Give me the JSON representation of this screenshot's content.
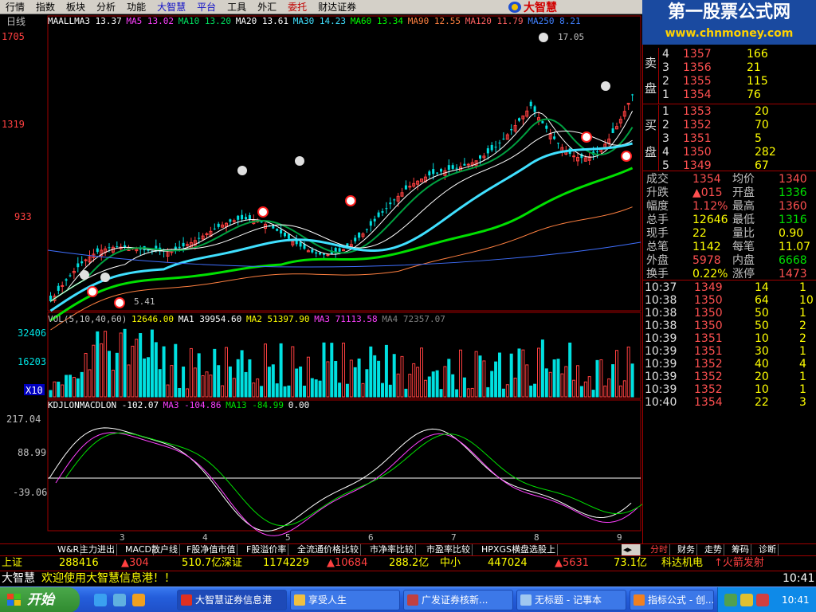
{
  "menubar": {
    "items": [
      "行情",
      "指数",
      "板块",
      "分析",
      "功能",
      "大智慧",
      "平台",
      "工具",
      "外汇",
      "委托",
      "财达证券"
    ]
  },
  "logo": {
    "text": "大智慧"
  },
  "banner": {
    "title": "第一股票公式网",
    "url": "www.chnmoney.com"
  },
  "main_chart": {
    "period_label": "日线",
    "ma_legend": [
      {
        "text": "MAALLMA3 13.37",
        "color": "#ffffff"
      },
      {
        "text": "MA5 13.02",
        "color": "#ff40ff"
      },
      {
        "text": "MA10 13.20",
        "color": "#00e060"
      },
      {
        "text": "MA20 13.61",
        "color": "#ffffff"
      },
      {
        "text": "MA30 14.23",
        "color": "#40e0ff"
      },
      {
        "text": "MA60 13.34",
        "color": "#00ff00"
      },
      {
        "text": "MA90 12.55",
        "color": "#ff8040"
      },
      {
        "text": "MA120 11.79",
        "color": "#ff6060"
      },
      {
        "text": "MA250 8.21",
        "color": "#4080ff"
      }
    ],
    "y_labels": [
      "1705",
      "1319",
      "933"
    ],
    "high_annotation": "17.05",
    "low_annotation": "5.41"
  },
  "volume": {
    "legend": [
      {
        "text": "VOL(5,10,40,60)",
        "color": "#c0c0c0"
      },
      {
        "text": "12646.00",
        "color": "#ffff00"
      },
      {
        "text": "MA1 39954.60",
        "color": "#ffffff"
      },
      {
        "text": "MA2 51397.90",
        "color": "#ffff00"
      },
      {
        "text": "MA3 71113.58",
        "color": "#ff40ff"
      },
      {
        "text": "MA4 72357.07",
        "color": "#808080"
      }
    ],
    "y_labels": [
      "32406",
      "16203"
    ],
    "unit_label": "X10"
  },
  "macd": {
    "legend": [
      {
        "text": "KDJLONMACDLON -102.07",
        "color": "#ffffff"
      },
      {
        "text": "MA3 -104.86",
        "color": "#ff40ff"
      },
      {
        "text": "MA13 -84.99",
        "color": "#00e000"
      },
      {
        "text": "0.00",
        "color": "#ffffff"
      }
    ],
    "y_labels": [
      "217.04",
      "88.99",
      "-39.06"
    ]
  },
  "x_labels": [
    "3",
    "4",
    "5",
    "6",
    "7",
    "8",
    "9"
  ],
  "sell_side": {
    "label_top": "卖",
    "label_bottom": "盘",
    "rows": [
      {
        "level": "4",
        "price": "1357",
        "vol": "166"
      },
      {
        "level": "3",
        "price": "1356",
        "vol": "21"
      },
      {
        "level": "2",
        "price": "1355",
        "vol": "115"
      },
      {
        "level": "1",
        "price": "1354",
        "vol": "76"
      }
    ]
  },
  "buy_side": {
    "label_top": "买",
    "label_bottom": "盘",
    "rows": [
      {
        "level": "1",
        "price": "1353",
        "vol": "20"
      },
      {
        "level": "2",
        "price": "1352",
        "vol": "70"
      },
      {
        "level": "3",
        "price": "1351",
        "vol": "5"
      },
      {
        "level": "4",
        "price": "1350",
        "vol": "282"
      },
      {
        "level": "5",
        "price": "1349",
        "vol": "67"
      }
    ]
  },
  "stats": [
    {
      "l1": "成交",
      "v1": "1354",
      "c1": "red",
      "l2": "均价",
      "v2": "1340",
      "c2": "red"
    },
    {
      "l1": "升跌",
      "v1": "▲015",
      "c1": "red",
      "l2": "开盘",
      "v2": "1336",
      "c2": "green"
    },
    {
      "l1": "幅度",
      "v1": "1.12%",
      "c1": "red",
      "l2": "最高",
      "v2": "1360",
      "c2": "red"
    },
    {
      "l1": "总手",
      "v1": "12646",
      "c1": "yellow",
      "l2": "最低",
      "v2": "1316",
      "c2": "green"
    },
    {
      "l1": "现手",
      "v1": "22",
      "c1": "yellow",
      "l2": "量比",
      "v2": "0.90",
      "c2": "yellow"
    },
    {
      "l1": "总笔",
      "v1": "1142",
      "c1": "yellow",
      "l2": "每笔",
      "v2": "11.07",
      "c2": "yellow"
    },
    {
      "l1": "外盘",
      "v1": "5978",
      "c1": "red",
      "l2": "内盘",
      "v2": "6668",
      "c2": "green"
    },
    {
      "l1": "换手",
      "v1": "0.22%",
      "c1": "yellow",
      "l2": "涨停",
      "v2": "1473",
      "c2": "red"
    }
  ],
  "ticks": [
    {
      "time": "10:37",
      "price": "1349",
      "vol": "14",
      "n": "1"
    },
    {
      "time": "10:38",
      "price": "1350",
      "vol": "64",
      "n": "10"
    },
    {
      "time": "10:38",
      "price": "1350",
      "vol": "50",
      "n": "1"
    },
    {
      "time": "10:38",
      "price": "1350",
      "vol": "50",
      "n": "2"
    },
    {
      "time": "10:39",
      "price": "1351",
      "vol": "10",
      "n": "2"
    },
    {
      "time": "10:39",
      "price": "1351",
      "vol": "30",
      "n": "1"
    },
    {
      "time": "10:39",
      "price": "1352",
      "vol": "40",
      "n": "4"
    },
    {
      "time": "10:39",
      "price": "1352",
      "vol": "20",
      "n": "1"
    },
    {
      "time": "10:39",
      "price": "1352",
      "vol": "10",
      "n": "1"
    },
    {
      "time": "10:40",
      "price": "1354",
      "vol": "22",
      "n": "3"
    }
  ],
  "bottom_tabs": [
    "W&R",
    "主力进出",
    "MACD",
    "散户线",
    "F股净值市值",
    "F股溢价率",
    "全流通价格比较",
    "市净率比较",
    "市盈率比较",
    "HPXGS横盘选股上"
  ],
  "side_tabs": [
    "分时",
    "财务",
    "走势",
    "筹码",
    "诊断"
  ],
  "ticker": {
    "sh_label": "上证",
    "sh_vol": "288416",
    "sh_chg": "▲304",
    "sh_amt": "510.7亿",
    "sz_label": "深证",
    "sz_vol": "1174229",
    "sz_chg": "▲10684",
    "sz_amt": "288.2亿",
    "zx_label": "中小",
    "zx_vol": "447024",
    "zx_chg": "▲5631",
    "zx_amt": "73.1亿",
    "stock": "科达机电",
    "news": "↑火箭发射"
  },
  "statusbar": {
    "brand": "大智慧",
    "message": "欢迎使用大智慧信息港！！",
    "time": "10:41"
  },
  "taskbar": {
    "start": "开始",
    "tasks": [
      "大智慧证券信息港",
      "享受人生",
      "广发证券核新...",
      "无标题 - 记事本",
      "指标公式 - 创..."
    ],
    "clock": "10:41"
  }
}
